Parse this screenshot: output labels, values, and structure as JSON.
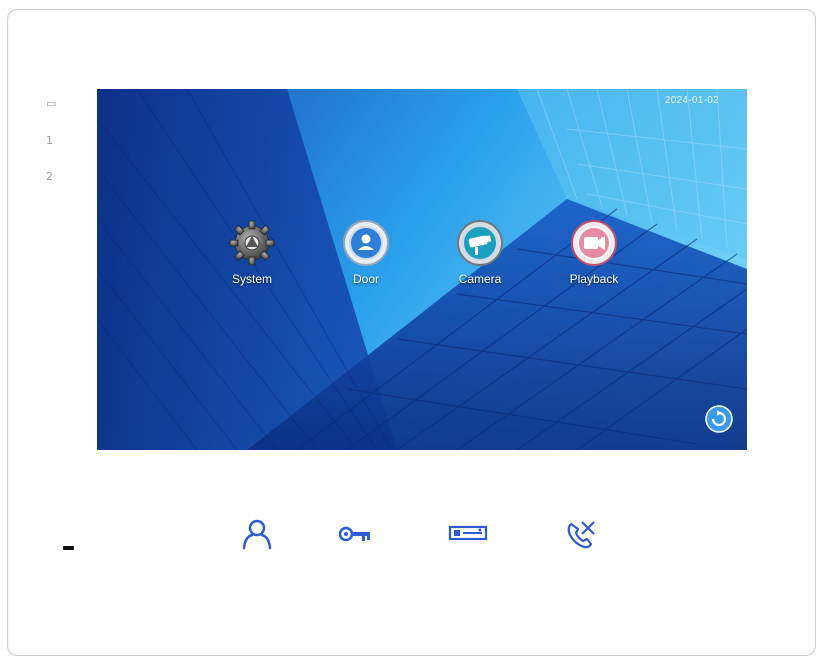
{
  "side_labels": {
    "top": "▭",
    "one": "1",
    "two": "2"
  },
  "screen": {
    "clock": "2024-01-02",
    "menu": [
      {
        "label": "System",
        "icon": "gear-icon"
      },
      {
        "label": "Door",
        "icon": "door-icon"
      },
      {
        "label": "Camera",
        "icon": "camera-icon"
      },
      {
        "label": "Playback",
        "icon": "playback-icon"
      }
    ],
    "refresh_icon": "refresh-icon"
  },
  "hardware_buttons": [
    {
      "icon": "person-icon"
    },
    {
      "icon": "key-icon"
    },
    {
      "icon": "monitor-icon"
    },
    {
      "icon": "hangup-phone-icon"
    }
  ],
  "colors": {
    "accent_blue": "#2f5bd6",
    "screen_blue": "#1e86e0"
  }
}
